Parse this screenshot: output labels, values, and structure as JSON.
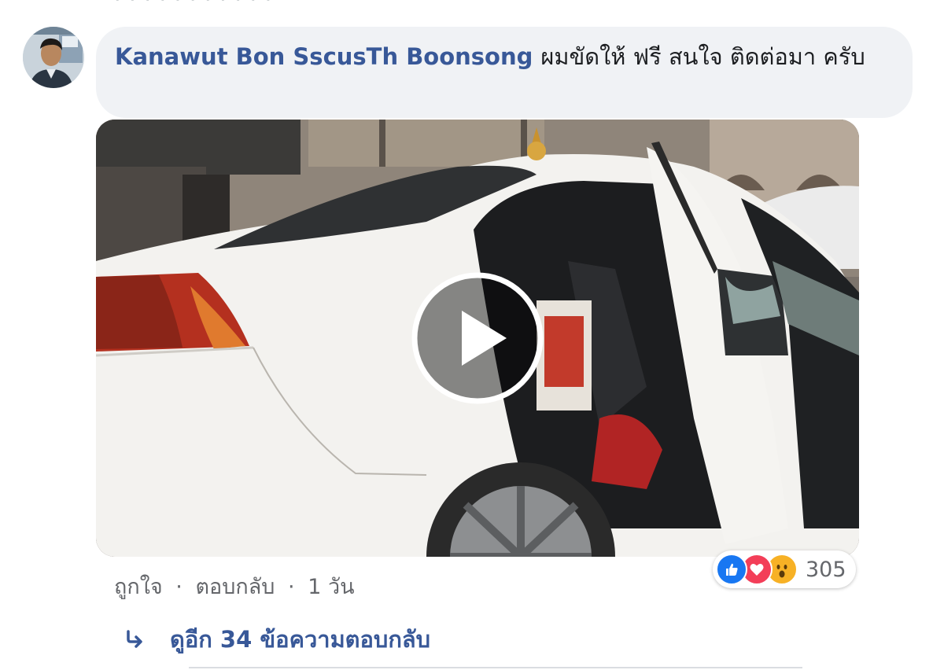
{
  "comment": {
    "author": "Kanawut Bon SscusTh Boonsong",
    "text": "ผมขัดให้ ฟรี สนใจ ติดต่อมา ครับ",
    "avatar_icon": "user-avatar"
  },
  "video": {
    "play_icon": "play-icon"
  },
  "actions": {
    "like_label": "ถูกใจ",
    "reply_label": "ตอบกลับ",
    "separator": "·",
    "time": "1 วัน"
  },
  "reactions": {
    "icons": [
      "like-icon",
      "love-icon",
      "wow-icon"
    ],
    "count": "305"
  },
  "replies": {
    "label": "ดูอีก 34 ข้อความตอบกลับ",
    "icon": "reply-arrow-icon"
  },
  "colors": {
    "author": "#385898",
    "bubble": "#f0f2f5",
    "like": "#1877f2",
    "love": "#f33e58",
    "wow": "#f7b125"
  }
}
